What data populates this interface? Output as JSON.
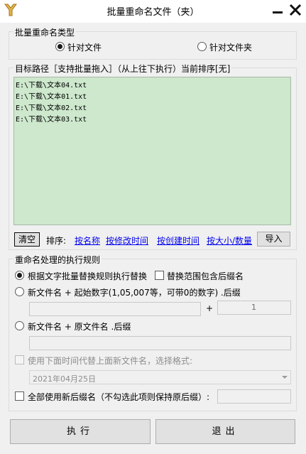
{
  "window": {
    "title": "批量重命名文件（夹）"
  },
  "rename_type": {
    "legend": "批量重命名类型",
    "options": [
      {
        "label": "针对文件",
        "checked": true
      },
      {
        "label": "针对文件夹",
        "checked": false
      }
    ]
  },
  "target": {
    "legend": "目标路径［支持批量拖入］（从上往下执行）当前排序[无]",
    "paths": [
      "E:\\下载\\文本04.txt",
      "E:\\下载\\文本01.txt",
      "E:\\下载\\文本02.txt",
      "E:\\下载\\文本03.txt"
    ],
    "clear_label": "清空",
    "sort_label": "排序:",
    "sort_links": [
      "按名称",
      "按修改时间",
      "按创建时间",
      "按大小/数量"
    ],
    "import_label": "导入"
  },
  "rules": {
    "legend": "重命名处理的执行规则",
    "rule1_label": "根据文字批量替换规则执行替换",
    "rule1_extra_label": "替换范围包含后缀名",
    "rule2_label": "新文件名 + 起始数字(1,05,007等，可带0的数字) .后缀",
    "plus_sign": "+",
    "start_number": "1",
    "rule3_label": "新文件名 + 原文件名 .后缀",
    "time_label": "使用下面时间代替上面新文件名，选择格式:",
    "time_value": "2021年04月25日",
    "ext_label": "全部使用新后缀名（不勾选此项则保持原后缀）:"
  },
  "actions": {
    "execute_label": "执行",
    "exit_label": "退出"
  }
}
